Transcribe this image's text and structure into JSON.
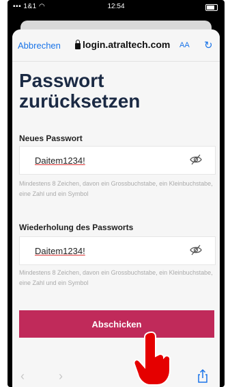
{
  "status_bar": {
    "carrier": "1&1",
    "time": "12:54"
  },
  "browser": {
    "cancel_label": "Abbrechen",
    "url": "login.atraltech.com",
    "text_size_label": "AA"
  },
  "page": {
    "title": "Passwort zurücksetzen",
    "new_password": {
      "label": "Neues Passwort",
      "value": "Daitem1234!",
      "hint": "Mindestens 8 Zeichen, davon ein Grossbuchstabe, ein Kleinbuchstabe, eine Zahl und ein Symbol"
    },
    "repeat_password": {
      "label": "Wiederholung des Passworts",
      "value": "Daitem1234!",
      "hint": "Mindestens 8 Zeichen, davon ein Grossbuchstabe, ein Kleinbuchstabe, eine Zahl und ein Symbol"
    },
    "submit_label": "Abschicken"
  },
  "colors": {
    "accent": "#c02a5a",
    "link": "#1a74e8",
    "title": "#1b2a44"
  }
}
